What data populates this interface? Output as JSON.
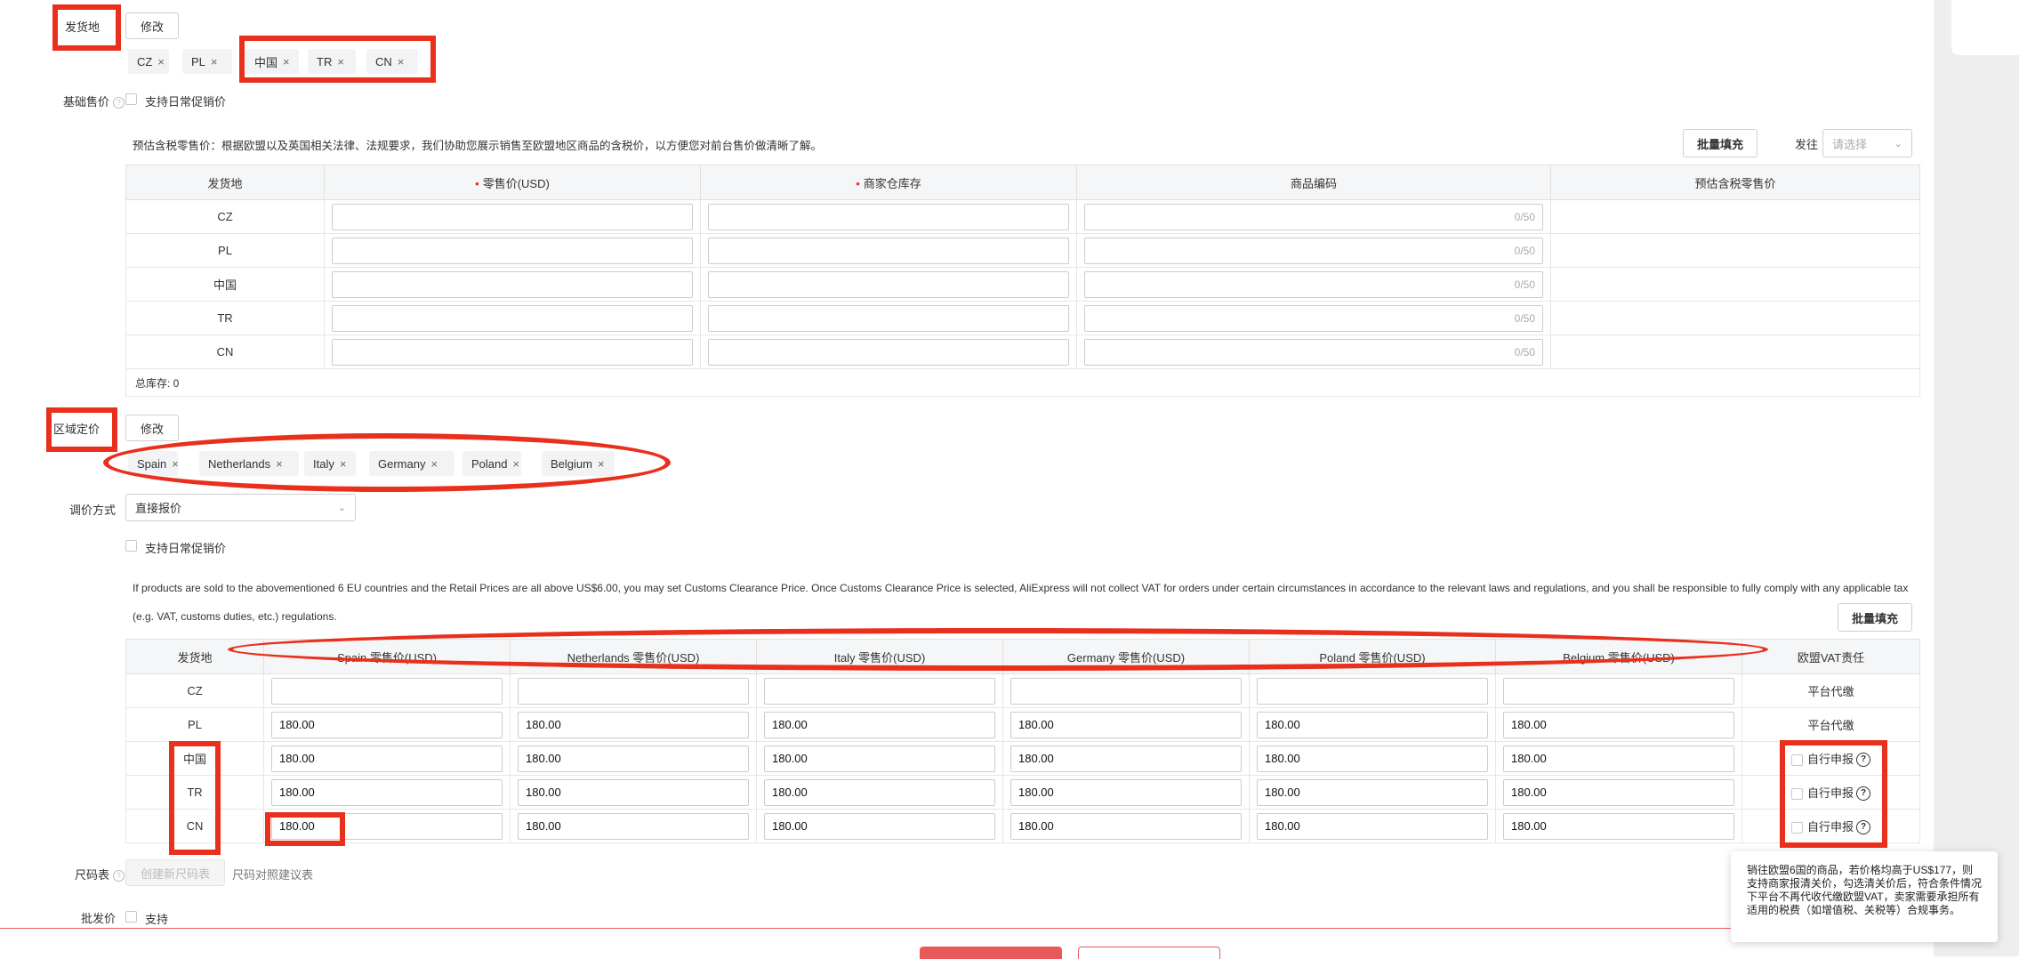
{
  "shipping_from": {
    "label": "发货地",
    "edit_label": "修改",
    "tags": [
      "CZ",
      "PL",
      "中国",
      "TR",
      "CN"
    ]
  },
  "base_price": {
    "label": "基础售价",
    "promo_label": "支持日常促销价",
    "note": "预估含税零售价：根据欧盟以及英国相关法律、法规要求，我们协助您展示销售至欧盟地区商品的含税价，以方便您对前台售价做清晰了解。",
    "bulk_fill": "批量填充",
    "ship_to_label": "发往",
    "ship_to_placeholder": "请选择",
    "headers": [
      "发货地",
      "零售价(USD)",
      "商家仓库存",
      "商品编码",
      "预估含税零售价"
    ],
    "rows": [
      {
        "origin": "CZ",
        "code_count": "0/50"
      },
      {
        "origin": "PL",
        "code_count": "0/50"
      },
      {
        "origin": "中国",
        "code_count": "0/50"
      },
      {
        "origin": "TR",
        "code_count": "0/50"
      },
      {
        "origin": "CN",
        "code_count": "0/50"
      }
    ],
    "total_stock": "总库存: 0"
  },
  "regional": {
    "label": "区域定价",
    "edit_label": "修改",
    "tags": [
      "Spain",
      "Netherlands",
      "Italy",
      "Germany",
      "Poland",
      "Belgium"
    ],
    "adjust_label": "调价方式",
    "adjust_value": "直接报价",
    "promo_label": "支持日常促销价",
    "note_line1": "If products are sold to the abovementioned 6 EU countries and the Retail Prices are all above US$6.00, you may set Customs Clearance Price. Once Customs Clearance Price is selected, AliExpress will not collect VAT for orders under certain circumstances in accordance to the relevant laws and regulations, and you shall be responsible to fully comply with any applicable tax",
    "note_line2": "(e.g. VAT, customs duties, etc.) regulations.",
    "bulk_fill": "批量填充",
    "headers": [
      "发货地",
      "Spain 零售价(USD)",
      "Netherlands 零售价(USD)",
      "Italy 零售价(USD)",
      "Germany 零售价(USD)",
      "Poland 零售价(USD)",
      "Belgium 零售价(USD)",
      "欧盟VAT责任"
    ],
    "rows": [
      {
        "origin": "CZ",
        "prices": [
          "",
          "",
          "",
          "",
          "",
          ""
        ],
        "vat": "平台代缴",
        "self_declare": false
      },
      {
        "origin": "PL",
        "prices": [
          "180.00",
          "180.00",
          "180.00",
          "180.00",
          "180.00",
          "180.00"
        ],
        "vat": "平台代缴",
        "self_declare": false
      },
      {
        "origin": "中国",
        "prices": [
          "180.00",
          "180.00",
          "180.00",
          "180.00",
          "180.00",
          "180.00"
        ],
        "vat": "自行申报",
        "self_declare": true
      },
      {
        "origin": "TR",
        "prices": [
          "180.00",
          "180.00",
          "180.00",
          "180.00",
          "180.00",
          "180.00"
        ],
        "vat": "自行申报",
        "self_declare": true
      },
      {
        "origin": "CN",
        "prices": [
          "180.00",
          "180.00",
          "180.00",
          "180.00",
          "180.00",
          "180.00"
        ],
        "vat": "自行申报",
        "self_declare": true
      }
    ]
  },
  "size_chart": {
    "label": "尺码表",
    "create_label": "创建新尺码表",
    "suggest_label": "尺码对照建议表"
  },
  "wholesale": {
    "label": "批发价",
    "support_label": "支持"
  },
  "tooltip": {
    "text": "销往欧盟6国的商品，若价格均高于US$177，则支持商家报清关价，勾选清关价后，符合条件情况下平台不再代收代缴欧盟VAT，卖家需要承担所有适用的税费（如增值税、关税等）合规事务。"
  },
  "colors": {
    "annotation_red": "#e8301c",
    "primary_red": "#e85a5a"
  }
}
